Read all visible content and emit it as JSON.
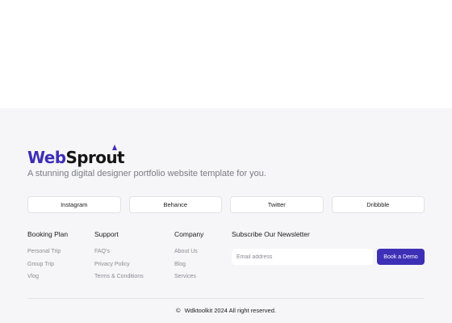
{
  "brand": {
    "logo_part1": "Web",
    "logo_part2": "Sprout",
    "tagline": "A stunning digital designer portfolio website template for you.",
    "accent_color": "#3d2fb6"
  },
  "socials": [
    {
      "label": "Instagram"
    },
    {
      "label": "Behance"
    },
    {
      "label": "Twitter"
    },
    {
      "label": "Dribbble"
    }
  ],
  "columns": {
    "booking": {
      "title": "Booking Plan",
      "links": [
        "Personal Trip",
        "Group Trip",
        "Vlog"
      ]
    },
    "support": {
      "title": "Support",
      "links": [
        "FAQ's",
        "Privacy Policy",
        "Terms & Conditions"
      ]
    },
    "company": {
      "title": "Company",
      "links": [
        "About Us",
        "Blog",
        "Services"
      ]
    }
  },
  "newsletter": {
    "title": "Subscribe Our Newsletter",
    "email_placeholder": "Email address",
    "button_label": "Book a Demo"
  },
  "footer": {
    "copyright_icon": "©",
    "copyright_text": "Wdktoolkit 2024 All right reserved."
  }
}
